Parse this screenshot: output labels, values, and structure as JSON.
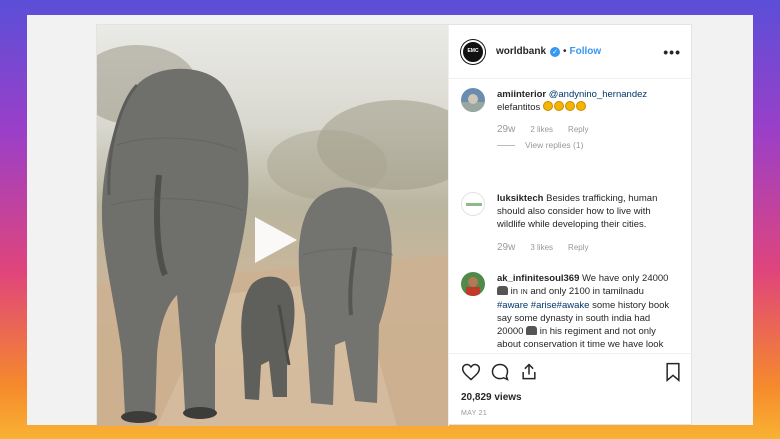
{
  "colors": {
    "accent": "#3897f0",
    "follow": "#3897f0",
    "text": "#262626",
    "muted": "#999999"
  },
  "header": {
    "username": "worldbank",
    "logo_text": "EMC",
    "dot": "•",
    "follow_label": "Follow",
    "more_label": "•••"
  },
  "media": {
    "play_icon": "play-icon"
  },
  "comments": [
    {
      "user": "amiinterior",
      "mention": "@andynino_hernandez",
      "text": "elefantitos",
      "emoji_count": 4,
      "time": "29w",
      "likes": "2 likes",
      "reply": "Reply",
      "view_replies": "View replies (1)"
    },
    {
      "user": "luksiktech",
      "text": "Besides trafficking, human should also consider how to live with wildlife while developing their cities.",
      "time": "29w",
      "likes": "3 likes",
      "reply": "Reply"
    },
    {
      "user": "ak_infinitesoul369",
      "text_a": "We have only 24000",
      "text_b": "in",
      "text_in": "IN",
      "text_c": "and only 2100 in tamilnadu",
      "hashtags": "#aware #arise#awake",
      "text_d": "some history book say some dynasty in south india had 20000",
      "text_e": "in his regiment and not only about conservation it time we have look for opportunities to grow grow grow"
    }
  ],
  "actions": {
    "views": "20,829 views",
    "date": "MAY 21"
  }
}
